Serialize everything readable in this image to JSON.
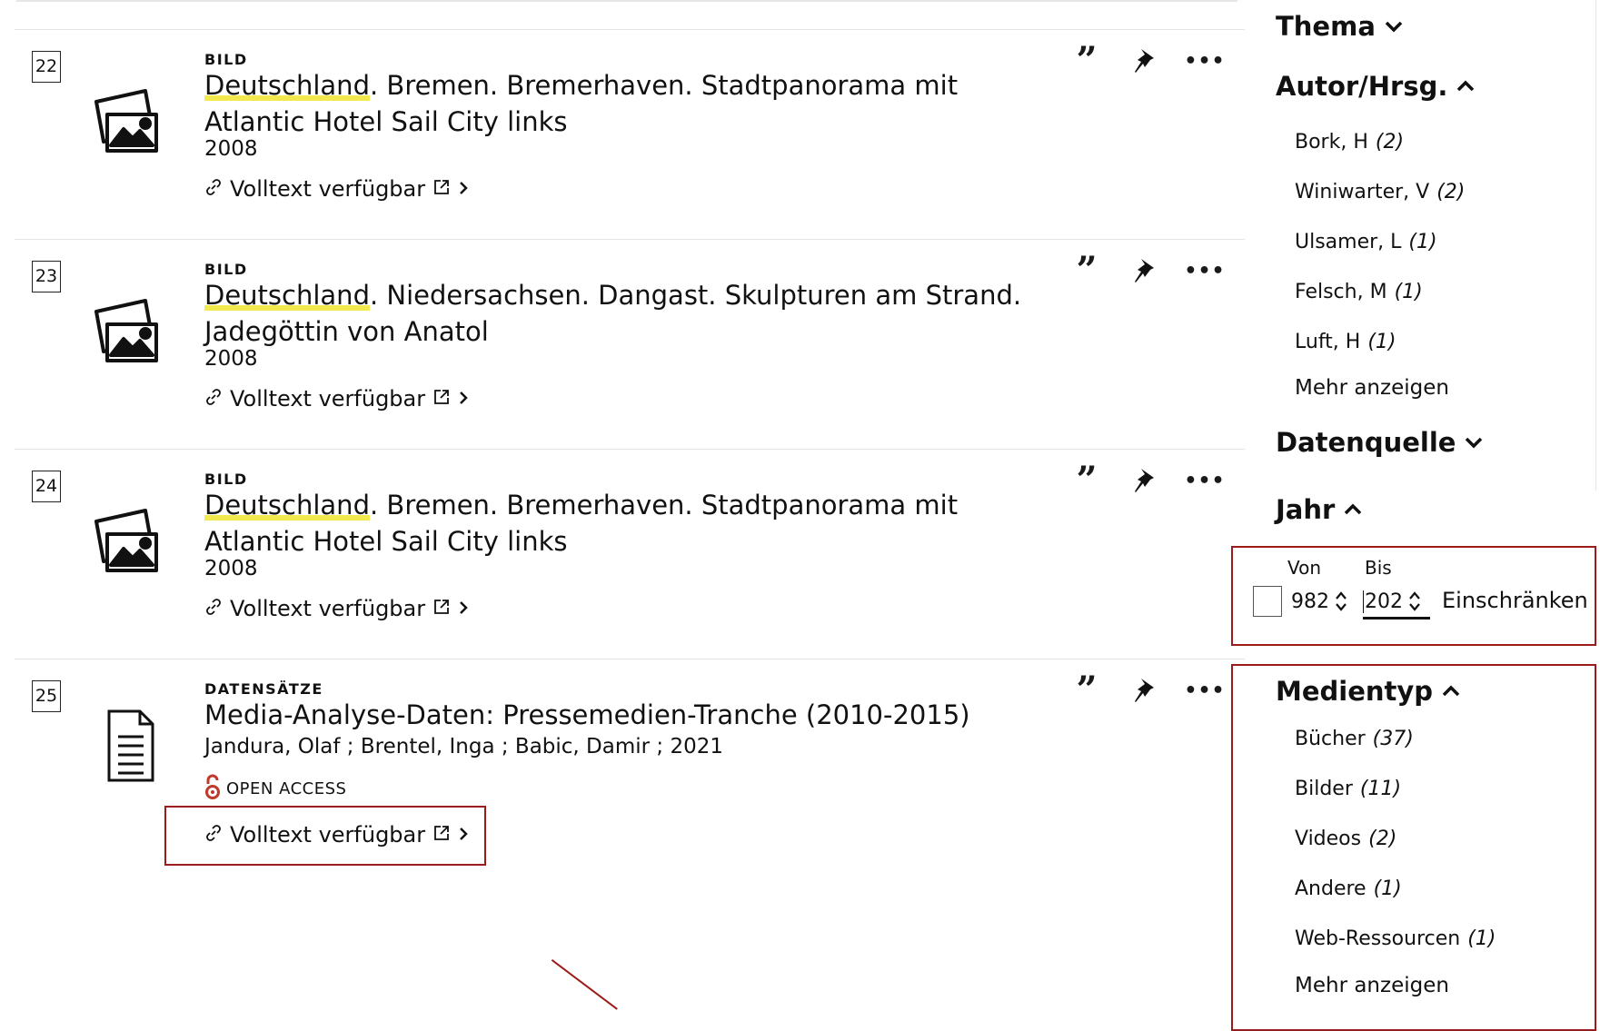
{
  "results": [
    {
      "number": "22",
      "type": "BILD",
      "title_highlight": "Deutschland",
      "title_rest": ". Bremen. Bremerhaven. Stadtpanorama mit Atlantic Hotel Sail City links",
      "meta": "2008",
      "fulltext": "Volltext verfügbar",
      "icon": "image-icon",
      "open_access": ""
    },
    {
      "number": "23",
      "type": "BILD",
      "title_highlight": "Deutschland",
      "title_rest": ". Niedersachsen. Dangast. Skulpturen am Strand. Jadegöttin von Anatol",
      "meta": "2008",
      "fulltext": "Volltext verfügbar",
      "icon": "image-icon",
      "open_access": ""
    },
    {
      "number": "24",
      "type": "BILD",
      "title_highlight": "Deutschland",
      "title_rest": ". Bremen. Bremerhaven. Stadtpanorama mit Atlantic Hotel Sail City links",
      "meta": "2008",
      "fulltext": "Volltext verfügbar",
      "icon": "image-icon",
      "open_access": ""
    },
    {
      "number": "25",
      "type": "DATENSÄTZE",
      "title_highlight": "",
      "title_rest": "Media-Analyse-Daten: Pressemedien-Tranche (2010-2015)",
      "meta": "Jandura, Olaf ; Brentel, Inga ; Babic, Damir ; 2021",
      "fulltext": "Volltext verfügbar",
      "icon": "document-icon",
      "open_access": "OPEN ACCESS"
    }
  ],
  "sidebar": {
    "thema": {
      "label": "Thema"
    },
    "autor": {
      "label": "Autor/Hrsg.",
      "items": [
        {
          "name": "Bork, H",
          "count": "(2)"
        },
        {
          "name": "Winiwarter, V",
          "count": "(2)"
        },
        {
          "name": "Ulsamer, L",
          "count": "(1)"
        },
        {
          "name": "Felsch, M",
          "count": "(1)"
        },
        {
          "name": "Luft, H",
          "count": "(1)"
        }
      ],
      "more": "Mehr anzeigen"
    },
    "datenquelle": {
      "label": "Datenquelle"
    },
    "jahr": {
      "label": "Jahr",
      "from_label": "Von",
      "to_label": "Bis",
      "from_value": "982",
      "to_value": "202",
      "apply": "Einschränken"
    },
    "medientyp": {
      "label": "Medientyp",
      "items": [
        {
          "name": "Bücher",
          "count": "(37)"
        },
        {
          "name": "Bilder",
          "count": "(11)"
        },
        {
          "name": "Videos",
          "count": "(2)"
        },
        {
          "name": "Andere",
          "count": "(1)"
        },
        {
          "name": "Web-Ressourcen",
          "count": "(1)"
        }
      ],
      "more": "Mehr anzeigen"
    }
  },
  "colors": {
    "highlight_box": "#9b1b1b",
    "open_access": "#c0392b",
    "search_highlight": "#f2e94e"
  }
}
